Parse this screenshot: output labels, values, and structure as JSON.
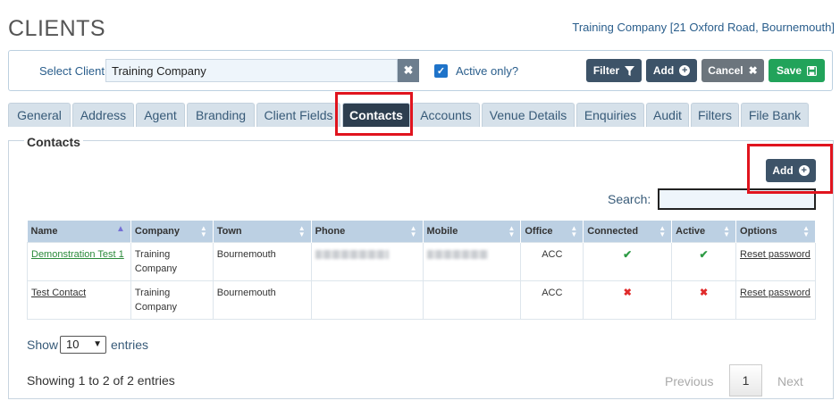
{
  "page": {
    "title": "CLIENTS",
    "company_info": "Training Company [21 Oxford Road, Bournemouth]"
  },
  "client_bar": {
    "select_label": "Select Client",
    "client_value": "Training Company",
    "clear_icon": "times-icon",
    "active_only_label": "Active only?",
    "active_only_checked": true,
    "buttons": {
      "filter": "Filter",
      "add": "Add",
      "cancel": "Cancel",
      "save": "Save"
    }
  },
  "tabs": [
    {
      "label": "General"
    },
    {
      "label": "Address"
    },
    {
      "label": "Agent"
    },
    {
      "label": "Branding"
    },
    {
      "label": "Client Fields"
    },
    {
      "label": "Contacts",
      "active": true
    },
    {
      "label": "Accounts"
    },
    {
      "label": "Venue Details"
    },
    {
      "label": "Enquiries"
    },
    {
      "label": "Audit"
    },
    {
      "label": "Filters"
    },
    {
      "label": "File Bank"
    }
  ],
  "contacts": {
    "legend": "Contacts",
    "add_label": "Add",
    "search_label": "Search:",
    "columns": [
      "Name",
      "Company",
      "Town",
      "Phone",
      "Mobile",
      "Office",
      "Connected",
      "Active",
      "Options"
    ],
    "rows": [
      {
        "name": "Demonstration Test 1",
        "company": "Training Company",
        "town": "Bournemouth",
        "phone": "(redacted)",
        "mobile": "(redacted)",
        "office": "ACC",
        "connected": "yes",
        "active": "yes",
        "option": "Reset password"
      },
      {
        "name": "Test Contact",
        "company": "Training Company",
        "town": "Bournemouth",
        "phone": "",
        "mobile": "",
        "office": "ACC",
        "connected": "no",
        "active": "no",
        "option": "Reset password"
      }
    ],
    "show_label": "Show",
    "entries_value": "10",
    "entries_label": "entries",
    "info": "Showing 1 to 2 of 2 entries",
    "pagination": {
      "previous": "Previous",
      "page": "1",
      "next": "Next"
    }
  },
  "colors": {
    "accent": "#3d5368",
    "save": "#21a35a",
    "highlight": "#e0141e",
    "tab_active": "#2d3e4f"
  }
}
